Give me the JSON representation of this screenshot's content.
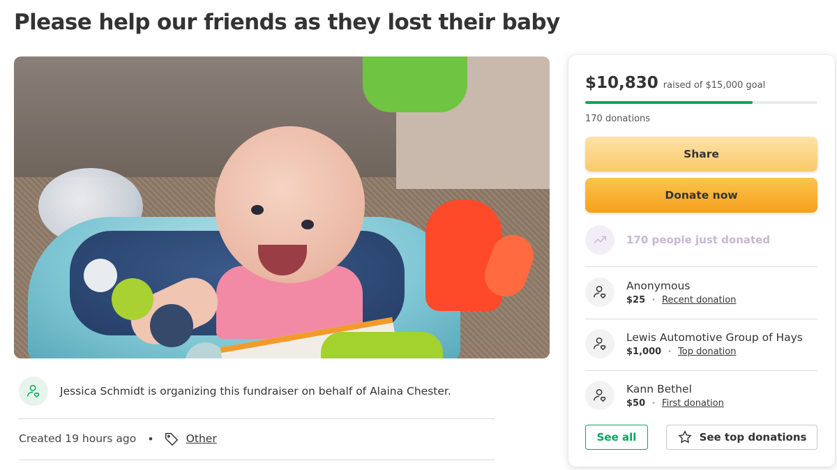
{
  "page": {
    "title": "Please help our friends as they lost their baby"
  },
  "organizer": {
    "text": "Jessica Schmidt is organizing this fundraiser on behalf of Alaina Chester.",
    "created": "Created 19 hours ago",
    "category": "Other"
  },
  "donation_card": {
    "raised": "$10,830",
    "goal_text": "raised of $15,000 goal",
    "progress_fraction": 0.722,
    "donations_count": "170 donations",
    "share_label": "Share",
    "donate_label": "Donate now",
    "just_donated": "170 people just donated",
    "donors": [
      {
        "name": "Anonymous",
        "amount": "$25",
        "type": "Recent donation"
      },
      {
        "name": "Lewis Automotive Group of Hays",
        "amount": "$1,000",
        "type": "Top donation"
      },
      {
        "name": "Kann Bethel",
        "amount": "$50",
        "type": "First donation"
      }
    ],
    "see_all_label": "See all",
    "see_top_label": "See top donations"
  },
  "colors": {
    "brand_green": "#02a95c",
    "donate_orange": "#f79f1c",
    "share_yellow": "#fcc86a"
  }
}
